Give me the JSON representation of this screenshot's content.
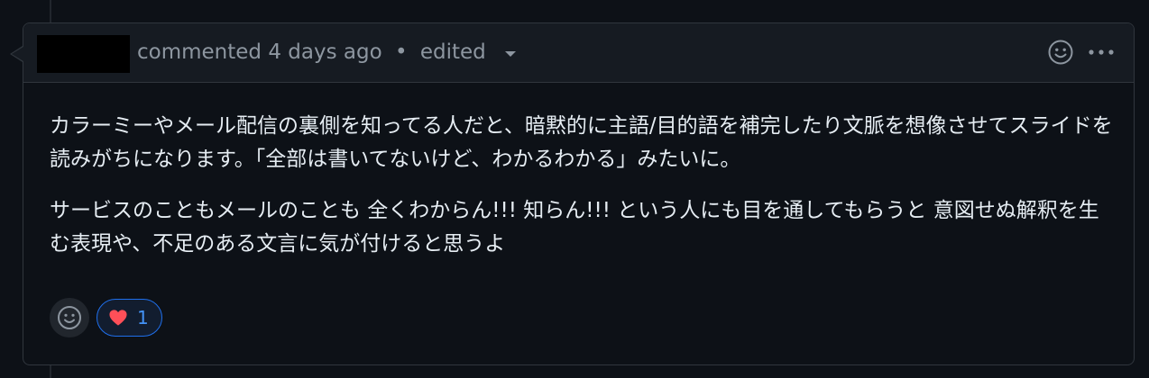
{
  "header": {
    "action_text": "commented 4 days ago",
    "separator": "•",
    "edited_label": "edited"
  },
  "body": {
    "paragraphs": [
      "カラーミーやメール配信の裏側を知ってる人だと、暗黙的に主語/目的語を補完したり文脈を想像させてスライドを読みがちになります。「全部は書いてないけど、わかるわかる」みたいに。",
      "サービスのこともメールのことも 全くわからん!!! 知らん!!! という人にも目を通してもらうと 意図せぬ解釈を生む表現や、不足のある文言に気が付けると思うよ"
    ]
  },
  "reactions": [
    {
      "emoji": "heart",
      "count": "1",
      "active": true
    }
  ],
  "colors": {
    "background": "#0d1117",
    "header_background": "#161b22",
    "border": "#30363d",
    "muted_text": "#8d96a0",
    "accent": "#1f6feb",
    "heart": "#ff4f58"
  },
  "icons": [
    "smiley-icon",
    "kebab-horizontal-icon",
    "caret-down-icon",
    "heart-icon"
  ]
}
